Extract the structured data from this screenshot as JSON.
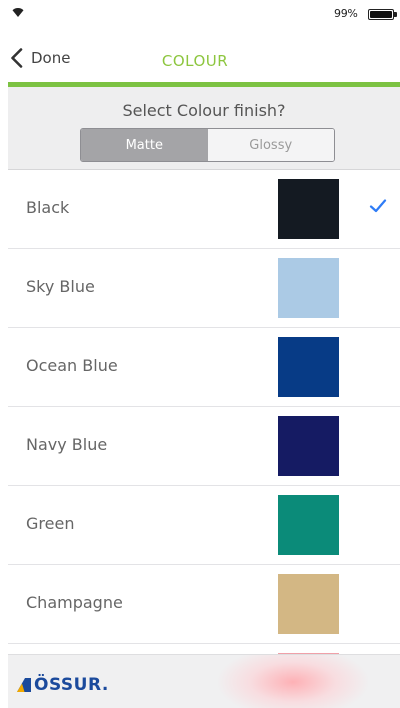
{
  "status_bar": {
    "battery_percent": "99%",
    "battery_level": 0.99
  },
  "nav": {
    "back_label": "Done",
    "title": "COLOUR",
    "accent_color": "#7cc242"
  },
  "finish": {
    "prompt": "Select Colour finish?",
    "options": [
      "Matte",
      "Glossy"
    ],
    "selected": "Matte"
  },
  "colors": [
    {
      "name": "Black",
      "swatch": "#141a22",
      "selected": true
    },
    {
      "name": "Sky Blue",
      "swatch": "#abcae5",
      "selected": false
    },
    {
      "name": "Ocean Blue",
      "swatch": "#073b86",
      "selected": false
    },
    {
      "name": "Navy Blue",
      "swatch": "#151b63",
      "selected": false
    },
    {
      "name": "Green",
      "swatch": "#0b8b79",
      "selected": false
    },
    {
      "name": "Champagne",
      "swatch": "#d3b784",
      "selected": false
    },
    {
      "name": "",
      "swatch": "#f0a0a8",
      "selected": false
    }
  ],
  "check_color": "#2f7cf6",
  "footer": {
    "logo_text": "ÖSSUR.",
    "brand_color": "#1b4a9c"
  }
}
